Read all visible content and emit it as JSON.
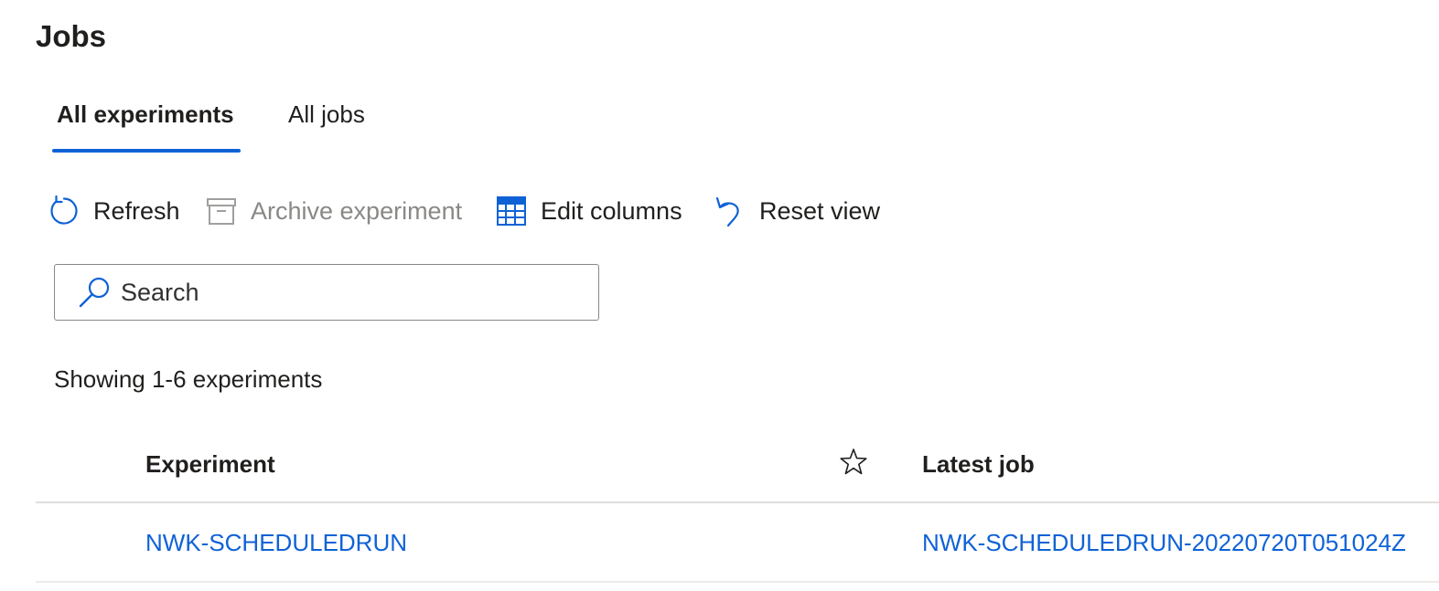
{
  "page": {
    "title": "Jobs"
  },
  "tabs": [
    {
      "label": "All experiments",
      "active": true
    },
    {
      "label": "All jobs",
      "active": false
    }
  ],
  "toolbar": {
    "refresh_label": "Refresh",
    "archive_label": "Archive experiment",
    "edit_columns_label": "Edit columns",
    "reset_view_label": "Reset view"
  },
  "search": {
    "placeholder": "Search",
    "value": ""
  },
  "summary": {
    "showing_text": "Showing 1-6 experiments"
  },
  "table": {
    "columns": [
      "Experiment",
      "Latest job"
    ],
    "rows": [
      {
        "experiment": "NWK-SCHEDULEDRUN",
        "latest_job": "NWK-SCHEDULEDRUN-20220720T051024Z"
      }
    ]
  },
  "colors": {
    "accent": "#0f62d6",
    "text": "#201f1e",
    "disabled": "#8a8886",
    "divider": "#e1dfdd"
  },
  "icons": {
    "refresh": "refresh-icon",
    "archive": "archive-icon",
    "edit_columns": "table-columns-icon",
    "reset_view": "undo-icon",
    "search": "search-icon",
    "favorite": "star-icon"
  }
}
